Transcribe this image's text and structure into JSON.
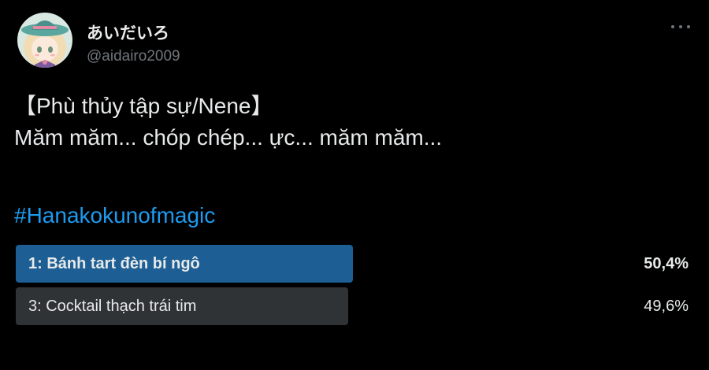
{
  "author": {
    "display_name": "あいだいろ",
    "handle": "@aidairo2009",
    "avatar_icon": "avatar-illustration-icon"
  },
  "menu": {
    "icon": "more-horizontal-icon"
  },
  "tweet": {
    "lines": [
      "【Phù thủy tập sự/Nene】",
      "Măm măm... chóp chép... ực... măm măm..."
    ],
    "hashtag": "#Hanakokunofmagic"
  },
  "poll": {
    "options": [
      {
        "label": "1: Bánh tart đèn bí ngô",
        "percent_text": "50,4%",
        "percent": 50.4,
        "winner": true,
        "bar_color": "#1d5f94"
      },
      {
        "label": "3: Cocktail thạch trái tim",
        "percent_text": "49,6%",
        "percent": 49.6,
        "winner": false,
        "bar_color": "#2f3336"
      }
    ]
  },
  "colors": {
    "background": "#000000",
    "text": "#e7e9ea",
    "secondary_text": "#71767b",
    "link": "#1d9bf0"
  }
}
